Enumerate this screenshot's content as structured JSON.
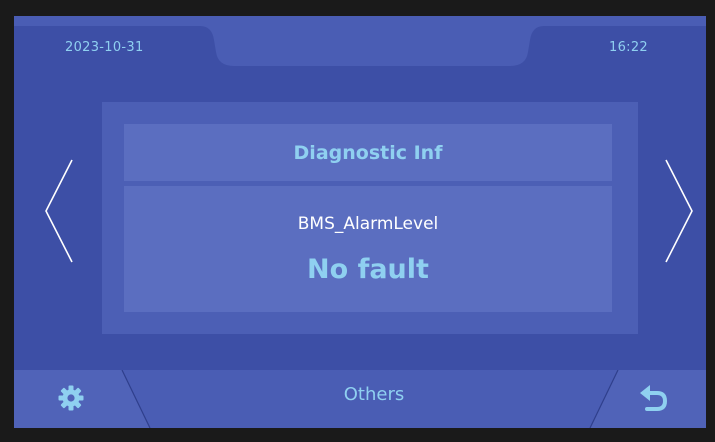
{
  "status_bar": {
    "date": "2023-10-31",
    "time": "16:22"
  },
  "diagnostic": {
    "title": "Diagnostic Inf",
    "parameter_name": "BMS_AlarmLevel",
    "parameter_value": "No fault"
  },
  "bottom_bar": {
    "center_label": "Others",
    "left_icon": "gear-icon",
    "right_icon": "back-arrow-icon"
  },
  "colors": {
    "background": "#3d4fa6",
    "panel": "#4c5fb5",
    "card": "#5b6ec0",
    "accent_text": "#8fd0f0",
    "white_text": "#ffffff"
  }
}
